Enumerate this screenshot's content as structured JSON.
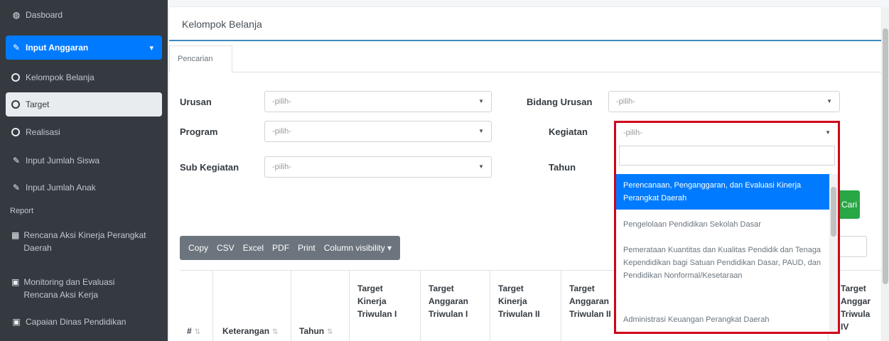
{
  "sidebar": {
    "items": [
      {
        "label": "Dasboard",
        "icon": "dashboard-icon"
      },
      {
        "label": "Input Anggaran",
        "icon": "edit-icon"
      },
      {
        "label": "Kelompok Belanja",
        "icon": "circle-icon"
      },
      {
        "label": "Target",
        "icon": "circle-icon"
      },
      {
        "label": "Realisasi",
        "icon": "circle-icon"
      },
      {
        "label": "Input Jumlah Siswa",
        "icon": "edit-icon"
      },
      {
        "label": "Input Jumlah Anak",
        "icon": "edit-icon"
      },
      {
        "label": "Rencana Aksi Kinerja Perangkat Daerah",
        "icon": "calendar-icon"
      },
      {
        "label": "Monitoring dan Evaluasi Rencana Aksi Kerja",
        "icon": "image-icon"
      },
      {
        "label": "Capaian Dinas Pendidikan",
        "icon": "image-icon"
      }
    ],
    "section_header": "Report",
    "expand_icon": "chevron-down-icon"
  },
  "card": {
    "title": "Kelompok Belanja",
    "tab_label": "Pencarian"
  },
  "filters": {
    "urusan": {
      "label": "Urusan",
      "value": "-pilih-"
    },
    "bidang_urusan": {
      "label": "Bidang Urusan",
      "value": "-pilih-"
    },
    "program": {
      "label": "Program",
      "value": "-pilih-"
    },
    "kegiatan": {
      "label": "Kegiatan",
      "value": "-pilih-"
    },
    "sub_kegiatan": {
      "label": "Sub Kegiatan",
      "value": "-pilih-"
    },
    "tahun": {
      "label": "Tahun"
    }
  },
  "dropdown": {
    "options": [
      "Perencanaan, Penganggaran, dan Evaluasi Kinerja Perangkat Daerah",
      "Pengelolaan Pendidikan Sekolah Dasar",
      "Pemerataan Kuantitas dan Kualitas Pendidik dan Tenaga Kependidikan bagi Satuan Pendidikan Dasar, PAUD, dan Pendidikan Nonformal/Kesetaraan",
      "Administrasi Keuangan Perangkat Daerah"
    ]
  },
  "cari_label": "Cari",
  "toolbar": {
    "buttons": [
      "Copy",
      "CSV",
      "Excel",
      "PDF",
      "Print",
      "Column visibility ▾"
    ]
  },
  "table": {
    "headers": [
      "#",
      "Keterangan",
      "Tahun",
      "Target Kinerja Triwulan I",
      "Target Anggaran Triwulan I",
      "Target Kinerja Triwulan II",
      "Target Anggaran Triwulan II",
      "Target Anggar Triwula IV"
    ]
  },
  "colors": {
    "sidebar_bg": "#343a40",
    "accent": "#007bff",
    "success": "#28a745",
    "highlight_border": "#d0021b"
  }
}
